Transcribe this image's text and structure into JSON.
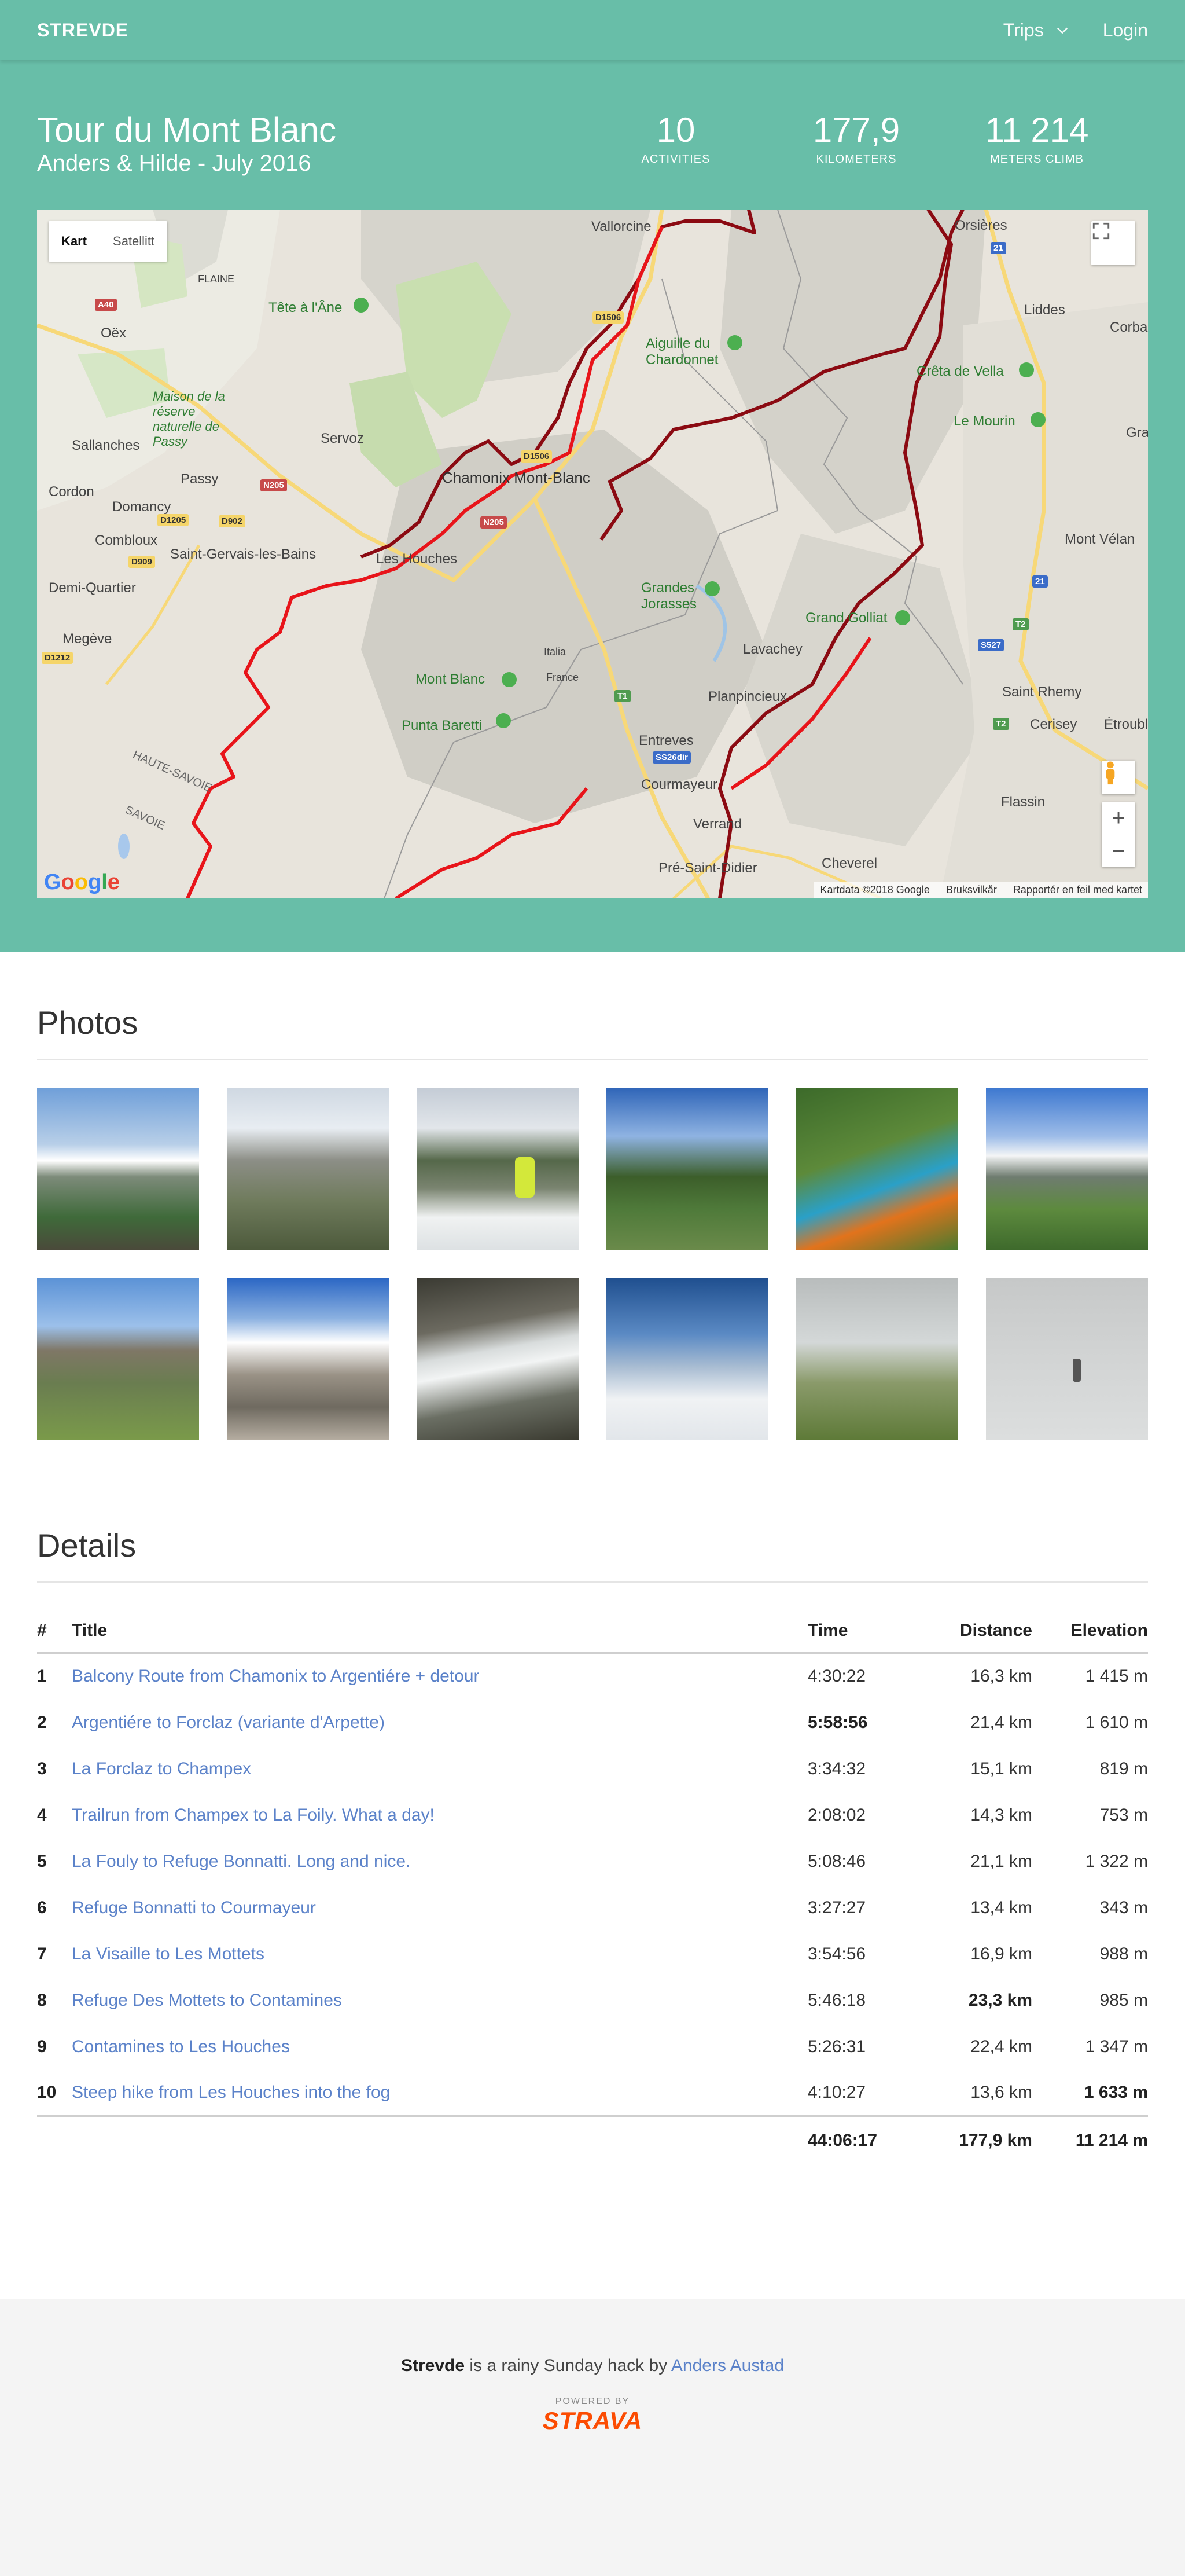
{
  "nav": {
    "brand": "STREVDE",
    "trips": "Trips",
    "login": "Login"
  },
  "hero": {
    "title": "Tour du Mont Blanc",
    "subtitle": "Anders & Hilde - July 2016",
    "stats": [
      {
        "value": "10",
        "label": "ACTIVITIES"
      },
      {
        "value": "177,9",
        "label": "KILOMETERS"
      },
      {
        "value": "11 214",
        "label": "METERS CLIMB"
      }
    ]
  },
  "map": {
    "type_active": "Kart",
    "type_other": "Satellitt",
    "logo": "Google",
    "attribution": [
      "Kartdata ©2018 Google",
      "Bruksvilkår",
      "Rapportér en feil med kartet"
    ],
    "places": [
      "Vallorcine",
      "Orsières",
      "FLAINE",
      "Tête à l'Âne",
      "Oëx",
      "Aiguille du Chardonnet",
      "Liddes",
      "Maison de la réserve naturelle de Passy",
      "Crêta de Vella",
      "Servoz",
      "Le Mourin",
      "Sallanches",
      "Passy",
      "Chamonix Mont-Blanc",
      "Cordon",
      "Domancy",
      "Combloux",
      "Saint-Gervais-les-Bains",
      "Les Houches",
      "Demi-Quartier",
      "Mont Vélan",
      "Grandes Jorasses",
      "Grand Golliat",
      "Megève",
      "Lavachey",
      "Mont Blanc",
      "Italia",
      "France",
      "Planpincieux",
      "Saint Rhemy",
      "Punta Baretti",
      "Cerisey",
      "Étroubles",
      "Entreves",
      "Courmayeur",
      "HAUTE-SAVOIE",
      "SAVOIE",
      "Flassin",
      "Verrand",
      "Pré-Saint-Didier",
      "Cheverel",
      "Corba",
      "Gra"
    ],
    "roads": [
      "A40",
      "D1506",
      "N205",
      "D1205",
      "D902",
      "D909",
      "D1212",
      "21",
      "S527",
      "T2",
      "T1",
      "SS26dir"
    ]
  },
  "photos": {
    "title": "Photos",
    "items": [
      "photo-1",
      "photo-2",
      "photo-3",
      "photo-4",
      "photo-5",
      "photo-6",
      "photo-7",
      "photo-8",
      "photo-9",
      "photo-10",
      "photo-11",
      "photo-12"
    ]
  },
  "details": {
    "title": "Details",
    "headers": {
      "num": "#",
      "title": "Title",
      "time": "Time",
      "distance": "Distance",
      "elevation": "Elevation"
    },
    "rows": [
      {
        "num": "1",
        "title": "Balcony Route from Chamonix to Argentiére + detour",
        "time": "4:30:22",
        "distance": "16,3 km",
        "elevation": "1 415 m"
      },
      {
        "num": "2",
        "title": "Argentiére to Forclaz (variante d'Arpette)",
        "time": "5:58:56",
        "distance": "21,4 km",
        "elevation": "1 610 m"
      },
      {
        "num": "3",
        "title": "La Forclaz to Champex",
        "time": "3:34:32",
        "distance": "15,1 km",
        "elevation": "819 m"
      },
      {
        "num": "4",
        "title": "Trailrun from Champex to La Foily. What a day!",
        "time": "2:08:02",
        "distance": "14,3 km",
        "elevation": "753 m"
      },
      {
        "num": "5",
        "title": "La Fouly to Refuge Bonnatti. Long and nice.",
        "time": "5:08:46",
        "distance": "21,1 km",
        "elevation": "1 322 m"
      },
      {
        "num": "6",
        "title": "Refuge Bonnatti to Courmayeur",
        "time": "3:27:27",
        "distance": "13,4 km",
        "elevation": "343 m"
      },
      {
        "num": "7",
        "title": "La Visaille to Les Mottets",
        "time": "3:54:56",
        "distance": "16,9 km",
        "elevation": "988 m"
      },
      {
        "num": "8",
        "title": "Refuge Des Mottets to Contamines",
        "time": "5:46:18",
        "distance": "23,3 km",
        "elevation": "985 m"
      },
      {
        "num": "9",
        "title": "Contamines to Les Houches",
        "time": "5:26:31",
        "distance": "22,4 km",
        "elevation": "1 347 m"
      },
      {
        "num": "10",
        "title": "Steep hike from Les Houches into the fog",
        "time": "4:10:27",
        "distance": "13,6 km",
        "elevation": "1 633 m"
      }
    ],
    "totals": {
      "time": "44:06:17",
      "distance": "177,9 km",
      "elevation": "11 214 m"
    }
  },
  "footer": {
    "brand": "Strevde",
    "text": " is a rainy Sunday hack by ",
    "author": "Anders Austad",
    "powered": "POWERED BY",
    "strava": "STRAVA"
  },
  "colors": {
    "teal": "#68bea8",
    "link": "#5b82c9",
    "route": "#e8141a",
    "route_dark": "#8b0a12",
    "strava": "#fc4c02"
  }
}
